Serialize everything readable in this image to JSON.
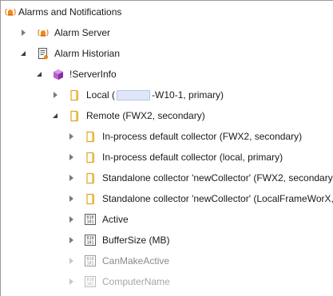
{
  "tree": {
    "root": {
      "label": "Alarms and Notifications",
      "icon": "alarm-bell-icon"
    },
    "alarm_server": {
      "label": "Alarm Server",
      "icon": "alarm-bell-icon"
    },
    "alarm_historian": {
      "label": "Alarm Historian",
      "icon": "historian-document-icon"
    },
    "server_info": {
      "label": "!ServerInfo",
      "icon": "purple-cube-icon"
    },
    "local": {
      "label_prefix": "Local (",
      "label_suffix": "-W10-1, primary)",
      "icon": "folder-icon"
    },
    "remote": {
      "label": "Remote (FWX2, secondary)",
      "icon": "folder-icon"
    },
    "collectors": [
      {
        "label": "In-process default collector (FWX2, secondary)",
        "icon": "folder-icon"
      },
      {
        "label": "In-process default collector (local, primary)",
        "icon": "folder-icon"
      },
      {
        "label": "Standalone collector 'newCollector' (FWX2, secondary",
        "icon": "folder-icon"
      },
      {
        "label": "Standalone collector 'newCollector' (LocalFrameWorX,",
        "icon": "folder-icon"
      }
    ],
    "properties": [
      {
        "label": "Active",
        "icon": "binary-tag-icon"
      },
      {
        "label": "BufferSize (MB)",
        "icon": "binary-tag-icon"
      },
      {
        "label": "CanMakeActive",
        "icon": "binary-tag-icon"
      },
      {
        "label": "ComputerName",
        "icon": "binary-tag-icon"
      }
    ]
  },
  "colors": {
    "alarm_orange": "#f08a1c",
    "folder_yellow": "#f4c542",
    "cube_purple": "#9b3fb5"
  }
}
